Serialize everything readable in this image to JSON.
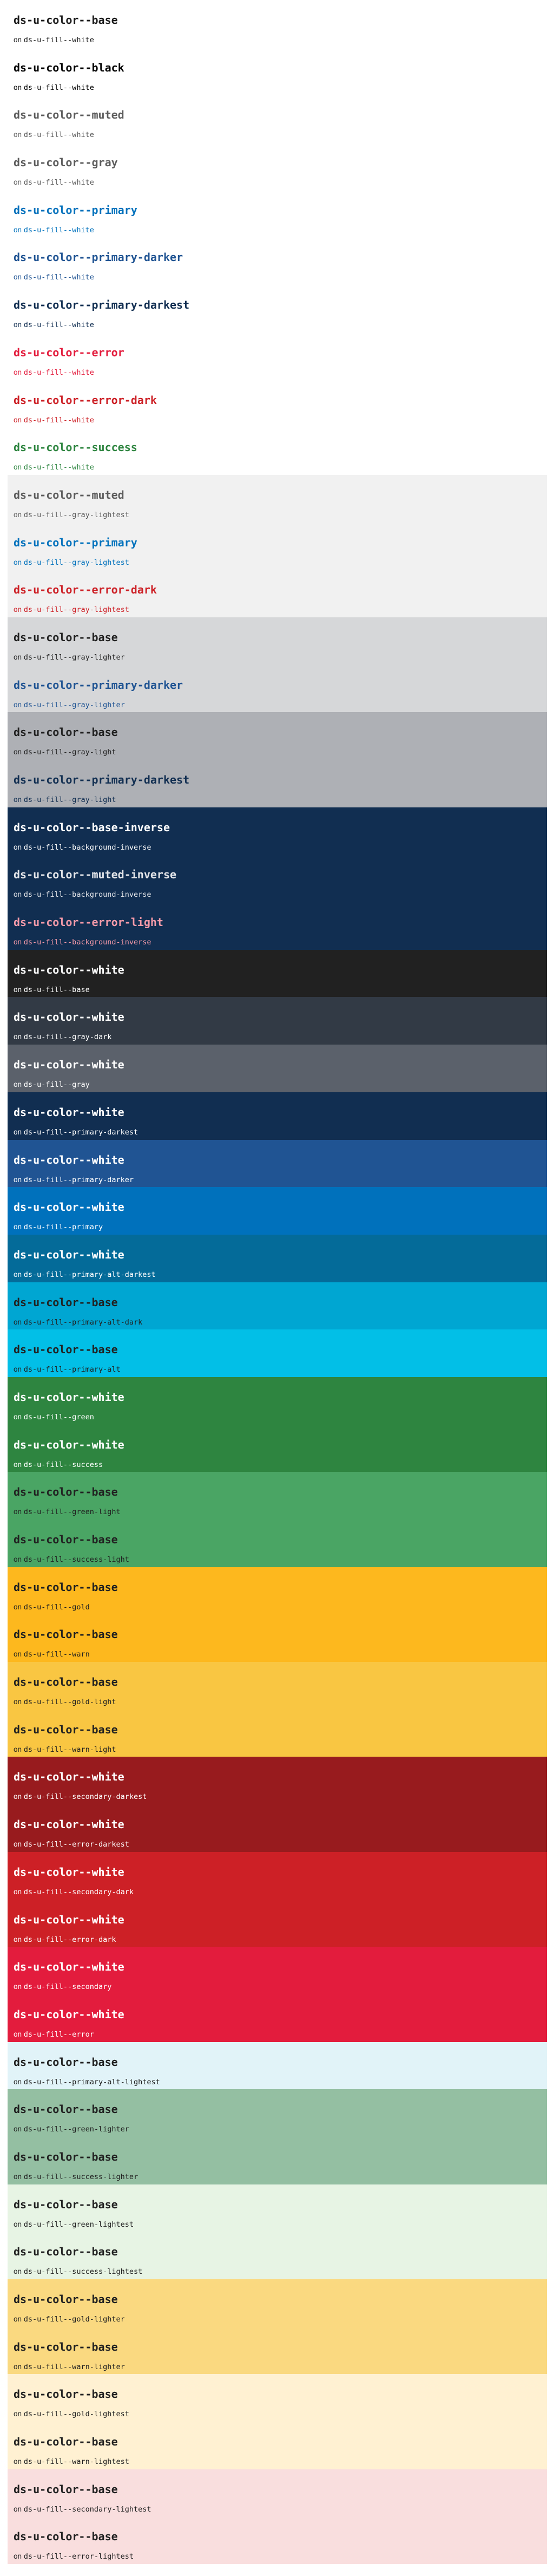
{
  "groups": [
    {
      "bg": "#ffffff",
      "items": [
        {
          "title": "ds-u-color--base",
          "fg": "#1b1b1b",
          "fill": "ds-u-fill--white"
        },
        {
          "title": "ds-u-color--black",
          "fg": "#000000",
          "fill": "ds-u-fill--white"
        },
        {
          "title": "ds-u-color--muted",
          "fg": "#5c5c5c",
          "fill": "ds-u-fill--white"
        },
        {
          "title": "ds-u-color--gray",
          "fg": "#5c5c5c",
          "fill": "ds-u-fill--white"
        },
        {
          "title": "ds-u-color--primary",
          "fg": "#0071bc",
          "fill": "ds-u-fill--white"
        },
        {
          "title": "ds-u-color--primary-darker",
          "fg": "#205493",
          "fill": "ds-u-fill--white"
        },
        {
          "title": "ds-u-color--primary-darkest",
          "fg": "#112e51",
          "fill": "ds-u-fill--white"
        },
        {
          "title": "ds-u-color--error",
          "fg": "#e31c3d",
          "fill": "ds-u-fill--white"
        },
        {
          "title": "ds-u-color--error-dark",
          "fg": "#cd2026",
          "fill": "ds-u-fill--white"
        },
        {
          "title": "ds-u-color--success",
          "fg": "#2e8540",
          "fill": "ds-u-fill--white"
        }
      ]
    },
    {
      "bg": "#f1f1f1",
      "items": [
        {
          "title": "ds-u-color--muted",
          "fg": "#5c5c5c",
          "fill": "ds-u-fill--gray-lightest"
        },
        {
          "title": "ds-u-color--primary",
          "fg": "#0071bc",
          "fill": "ds-u-fill--gray-lightest"
        },
        {
          "title": "ds-u-color--error-dark",
          "fg": "#cd2026",
          "fill": "ds-u-fill--gray-lightest"
        }
      ]
    },
    {
      "bg": "#d6d7d9",
      "items": [
        {
          "title": "ds-u-color--base",
          "fg": "#212121",
          "fill": "ds-u-fill--gray-lighter"
        },
        {
          "title": "ds-u-color--primary-darker",
          "fg": "#205493",
          "fill": "ds-u-fill--gray-lighter"
        }
      ]
    },
    {
      "bg": "#aeb0b5",
      "items": [
        {
          "title": "ds-u-color--base",
          "fg": "#212121",
          "fill": "ds-u-fill--gray-light"
        },
        {
          "title": "ds-u-color--primary-darkest",
          "fg": "#112e51",
          "fill": "ds-u-fill--gray-light"
        }
      ]
    },
    {
      "bg": "#112e51",
      "items": [
        {
          "title": "ds-u-color--base-inverse",
          "fg": "#ffffff",
          "fill": "ds-u-fill--background-inverse"
        },
        {
          "title": "ds-u-color--muted-inverse",
          "fg": "#e4e6ea",
          "fill": "ds-u-fill--background-inverse"
        },
        {
          "title": "ds-u-color--error-light",
          "fg": "#f49aa9",
          "fill": "ds-u-fill--background-inverse"
        }
      ]
    },
    {
      "bg": "#212121",
      "items": [
        {
          "title": "ds-u-color--white",
          "fg": "#ffffff",
          "fill": "ds-u-fill--base"
        }
      ]
    },
    {
      "bg": "#323a45",
      "items": [
        {
          "title": "ds-u-color--white",
          "fg": "#ffffff",
          "fill": "ds-u-fill--gray-dark"
        }
      ]
    },
    {
      "bg": "#5b616b",
      "items": [
        {
          "title": "ds-u-color--white",
          "fg": "#ffffff",
          "fill": "ds-u-fill--gray"
        }
      ]
    },
    {
      "bg": "#112e51",
      "items": [
        {
          "title": "ds-u-color--white",
          "fg": "#ffffff",
          "fill": "ds-u-fill--primary-darkest"
        }
      ]
    },
    {
      "bg": "#205493",
      "items": [
        {
          "title": "ds-u-color--white",
          "fg": "#ffffff",
          "fill": "ds-u-fill--primary-darker"
        }
      ]
    },
    {
      "bg": "#0071bc",
      "items": [
        {
          "title": "ds-u-color--white",
          "fg": "#ffffff",
          "fill": "ds-u-fill--primary"
        }
      ]
    },
    {
      "bg": "#046b99",
      "items": [
        {
          "title": "ds-u-color--white",
          "fg": "#ffffff",
          "fill": "ds-u-fill--primary-alt-darkest"
        }
      ]
    },
    {
      "bg": "#00a6d2",
      "items": [
        {
          "title": "ds-u-color--base",
          "fg": "#212121",
          "fill": "ds-u-fill--primary-alt-dark"
        }
      ]
    },
    {
      "bg": "#02bfe7",
      "items": [
        {
          "title": "ds-u-color--base",
          "fg": "#212121",
          "fill": "ds-u-fill--primary-alt"
        }
      ]
    },
    {
      "bg": "#2e8540",
      "items": [
        {
          "title": "ds-u-color--white",
          "fg": "#ffffff",
          "fill": "ds-u-fill--green"
        },
        {
          "title": "ds-u-color--white",
          "fg": "#ffffff",
          "fill": "ds-u-fill--success"
        }
      ]
    },
    {
      "bg": "#4aa564",
      "items": [
        {
          "title": "ds-u-color--base",
          "fg": "#212121",
          "fill": "ds-u-fill--green-light"
        },
        {
          "title": "ds-u-color--base",
          "fg": "#212121",
          "fill": "ds-u-fill--success-light"
        }
      ]
    },
    {
      "bg": "#fdb81e",
      "items": [
        {
          "title": "ds-u-color--base",
          "fg": "#212121",
          "fill": "ds-u-fill--gold"
        },
        {
          "title": "ds-u-color--base",
          "fg": "#212121",
          "fill": "ds-u-fill--warn"
        }
      ]
    },
    {
      "bg": "#f9c642",
      "items": [
        {
          "title": "ds-u-color--base",
          "fg": "#212121",
          "fill": "ds-u-fill--gold-light"
        },
        {
          "title": "ds-u-color--base",
          "fg": "#212121",
          "fill": "ds-u-fill--warn-light"
        }
      ]
    },
    {
      "bg": "#981b1e",
      "items": [
        {
          "title": "ds-u-color--white",
          "fg": "#ffffff",
          "fill": "ds-u-fill--secondary-darkest"
        },
        {
          "title": "ds-u-color--white",
          "fg": "#ffffff",
          "fill": "ds-u-fill--error-darkest"
        }
      ]
    },
    {
      "bg": "#cd2026",
      "items": [
        {
          "title": "ds-u-color--white",
          "fg": "#ffffff",
          "fill": "ds-u-fill--secondary-dark"
        },
        {
          "title": "ds-u-color--white",
          "fg": "#ffffff",
          "fill": "ds-u-fill--error-dark"
        }
      ]
    },
    {
      "bg": "#e31c3d",
      "items": [
        {
          "title": "ds-u-color--white",
          "fg": "#ffffff",
          "fill": "ds-u-fill--secondary"
        },
        {
          "title": "ds-u-color--white",
          "fg": "#ffffff",
          "fill": "ds-u-fill--error"
        }
      ]
    },
    {
      "bg": "#e1f3f8",
      "items": [
        {
          "title": "ds-u-color--base",
          "fg": "#212121",
          "fill": "ds-u-fill--primary-alt-lightest"
        }
      ]
    },
    {
      "bg": "#94bfa2",
      "items": [
        {
          "title": "ds-u-color--base",
          "fg": "#212121",
          "fill": "ds-u-fill--green-lighter"
        },
        {
          "title": "ds-u-color--base",
          "fg": "#212121",
          "fill": "ds-u-fill--success-lighter"
        }
      ]
    },
    {
      "bg": "#e7f4e4",
      "items": [
        {
          "title": "ds-u-color--base",
          "fg": "#212121",
          "fill": "ds-u-fill--green-lightest"
        },
        {
          "title": "ds-u-color--base",
          "fg": "#212121",
          "fill": "ds-u-fill--success-lightest"
        }
      ]
    },
    {
      "bg": "#fad980",
      "items": [
        {
          "title": "ds-u-color--base",
          "fg": "#212121",
          "fill": "ds-u-fill--gold-lighter"
        },
        {
          "title": "ds-u-color--base",
          "fg": "#212121",
          "fill": "ds-u-fill--warn-lighter"
        }
      ]
    },
    {
      "bg": "#fff1d2",
      "items": [
        {
          "title": "ds-u-color--base",
          "fg": "#212121",
          "fill": "ds-u-fill--gold-lightest"
        },
        {
          "title": "ds-u-color--base",
          "fg": "#212121",
          "fill": "ds-u-fill--warn-lightest"
        }
      ]
    },
    {
      "bg": "#f9dede",
      "items": [
        {
          "title": "ds-u-color--base",
          "fg": "#212121",
          "fill": "ds-u-fill--secondary-lightest"
        },
        {
          "title": "ds-u-color--base",
          "fg": "#212121",
          "fill": "ds-u-fill--error-lightest"
        }
      ]
    }
  ]
}
